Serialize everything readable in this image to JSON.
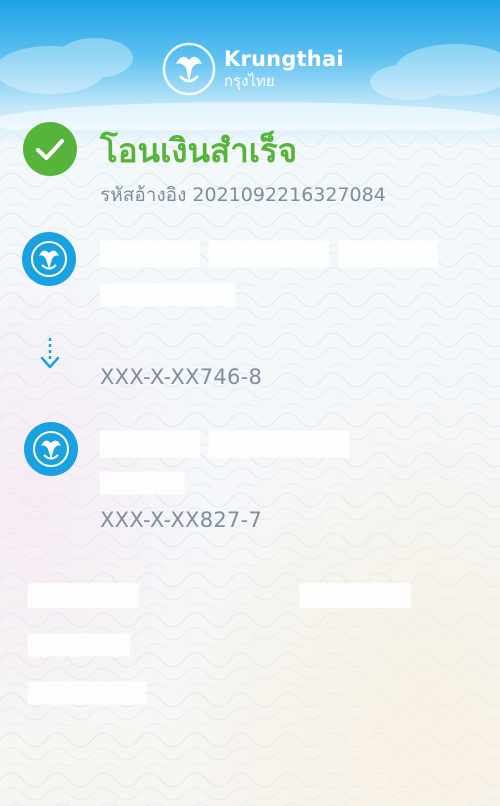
{
  "header": {
    "brand_en": "Krungthai",
    "brand_th": "กรุงไทย",
    "logo_icon": "phoenix-logo-icon"
  },
  "status": {
    "title": "โอนเงินสำเร็จ",
    "reference": "รหัสอ้างอิง 2021092216327084",
    "icon": "check-circle-icon"
  },
  "transfer": {
    "from_account": "XXX-X-XX746-8",
    "to_account": "XXX-X-XX827-7",
    "arrow_icon": "dotted-arrow-down-icon"
  },
  "colors": {
    "header_blue": "#1ea3e6",
    "success_green": "#57b43a",
    "avatar_blue": "#1aa2e0",
    "muted_text": "#7f8e9b"
  }
}
